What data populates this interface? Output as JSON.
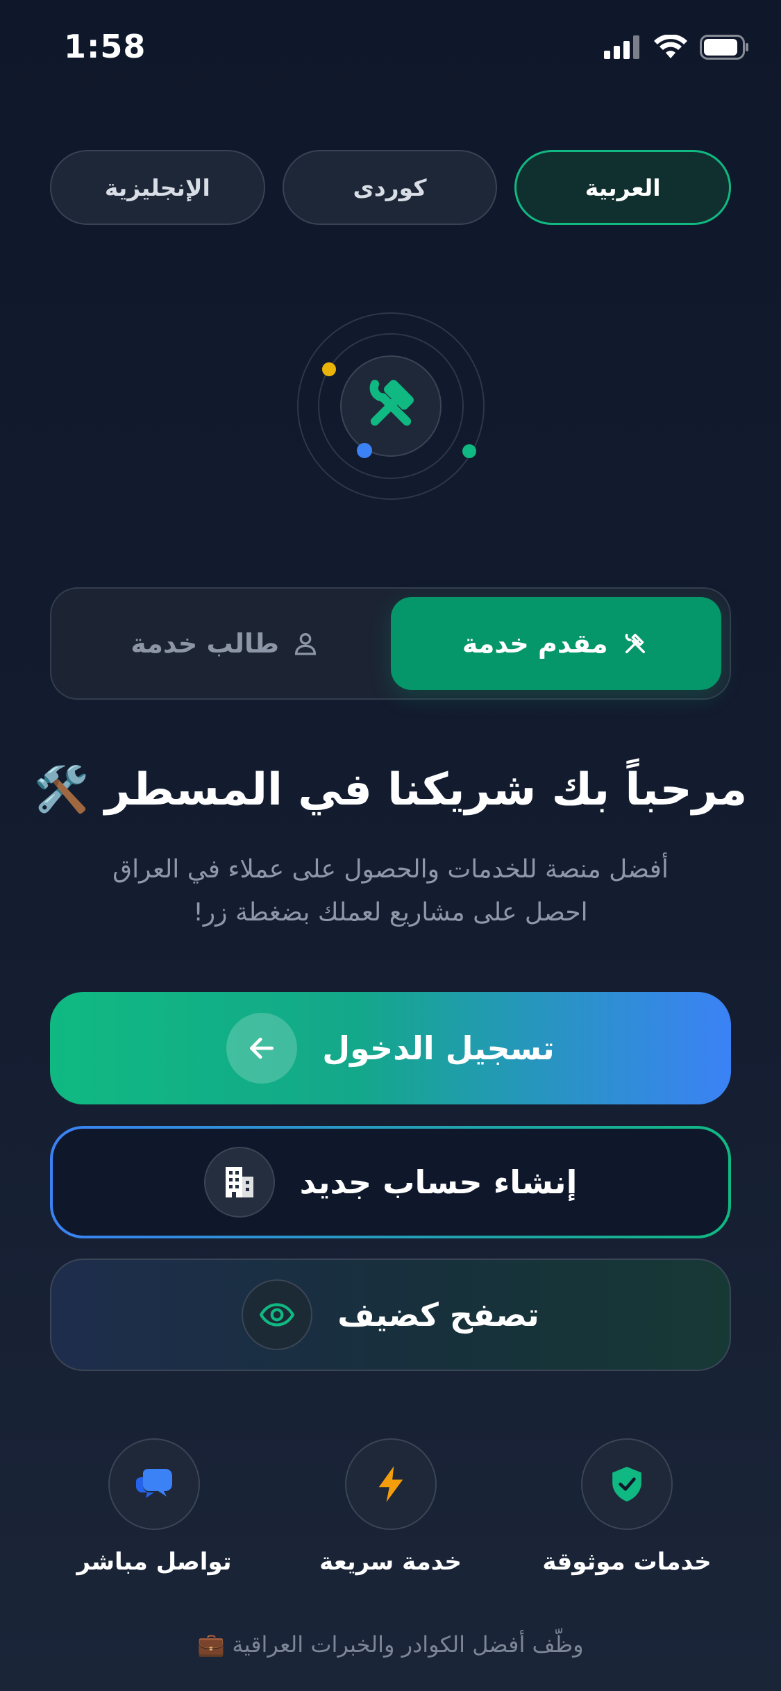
{
  "status": {
    "time": "1:58"
  },
  "languages": [
    {
      "label": "العربية",
      "active": true
    },
    {
      "label": "كوردى",
      "active": false
    },
    {
      "label": "الإنجليزية",
      "active": false
    }
  ],
  "role_toggle": {
    "provider_label": "مقدم خدمة",
    "seeker_label": "طالب خدمة"
  },
  "welcome": {
    "title": "مرحباً بك شريكنا في المسطر 🛠️",
    "line1": "أفضل منصة للخدمات والحصول على عملاء في العراق",
    "line2": "احصل على مشاريع لعملك بضغطة زر!"
  },
  "buttons": {
    "login": "تسجيل الدخول",
    "register": "إنشاء حساب جديد",
    "guest": "تصفح كضيف"
  },
  "features": [
    {
      "label": "خدمات موثوقة",
      "icon": "shield-check-icon",
      "color": "#10b981"
    },
    {
      "label": "خدمة سريعة",
      "icon": "lightning-icon",
      "color": "#f59e0b"
    },
    {
      "label": "تواصل مباشر",
      "icon": "chat-bubbles-icon",
      "color": "#3b82f6"
    }
  ],
  "footer": "وظّف أفضل الكوادر والخبرات العراقية 💼",
  "colors": {
    "accent": "#10b981",
    "blue": "#3b82f6",
    "background": "#0f172a"
  }
}
